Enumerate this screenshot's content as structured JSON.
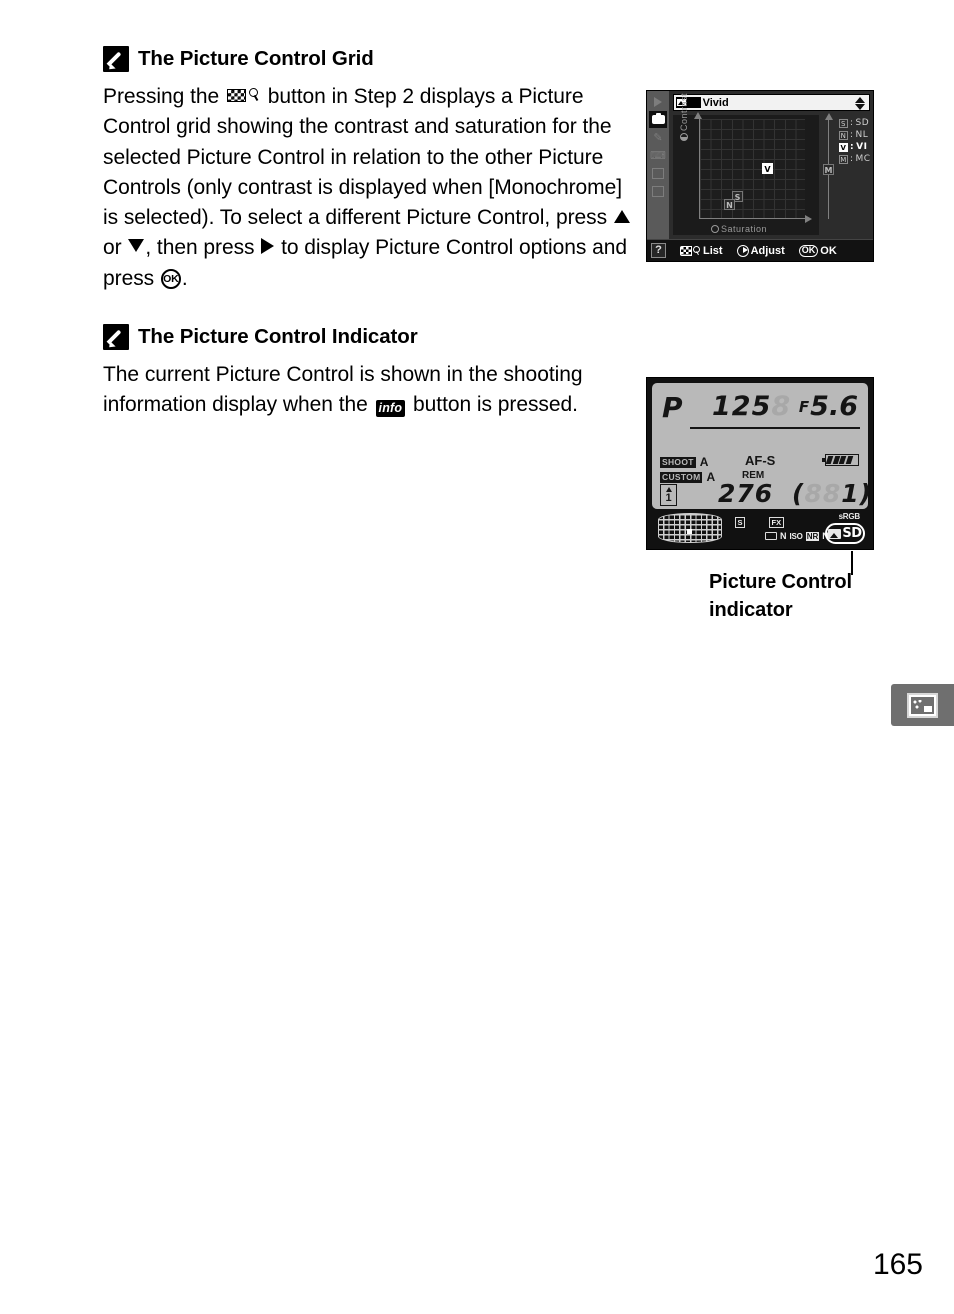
{
  "page": {
    "number": "165"
  },
  "notes": [
    {
      "icon": "pencil-icon",
      "title": "The Picture Control Grid",
      "body_segments": [
        "Pressing the ",
        " button in Step 2 displays a Picture Control grid showing the contrast and saturation for the selected Picture Control in relation to the other Picture Controls (only contrast is displayed when [Monochrome] is selected).  To select a different Picture Control, press ",
        " or ",
        ", then press ",
        " to display Picture Control options and press ",
        "."
      ],
      "icons_inline": [
        "thumbnail-zoom-out-button",
        "multi-selector-up",
        "multi-selector-down",
        "multi-selector-right",
        "ok-button"
      ]
    },
    {
      "icon": "pencil-icon",
      "title": "The Picture Control Indicator",
      "body_segments": [
        "The current Picture Control is shown in the shooting information display when the ",
        " button is pressed."
      ],
      "icons_inline": [
        "info-button"
      ],
      "info_label": "info"
    }
  ],
  "grid_lcd": {
    "title_code": "VI",
    "title_name": "Vivid",
    "axis_y": "Contrast",
    "axis_x": "Saturation",
    "markers": [
      {
        "code": "V",
        "selected": true,
        "x": 62,
        "y": 44
      },
      {
        "code": "S",
        "selected": false,
        "x": 32,
        "y": 72
      },
      {
        "code": "N",
        "selected": false,
        "x": 24,
        "y": 80
      }
    ],
    "mono_marker": {
      "code": "M",
      "selected": false
    },
    "legend": [
      {
        "chip": "S",
        "code": "SD",
        "selected": false
      },
      {
        "chip": "N",
        "code": "NL",
        "selected": false
      },
      {
        "chip": "V",
        "code": "VI",
        "selected": true
      },
      {
        "chip": "M",
        "code": "MC",
        "selected": false
      }
    ],
    "sidebar_icons": [
      "playback-icon",
      "shooting-menu-icon",
      "custom-settings-pencil-icon",
      "setup-wrench-icon",
      "retouch-icon",
      "recent-settings-icon",
      "help-icon"
    ],
    "help_label": "?",
    "footer": [
      {
        "icon": "thumbnail-list-icon",
        "label": "List"
      },
      {
        "icon": "command-dial-icon",
        "label": "Adjust"
      },
      {
        "icon": "ok-button-icon",
        "label": "OK",
        "badge": "OK"
      }
    ]
  },
  "info_lcd": {
    "exposure_mode": "P",
    "shutter_speed": "125",
    "shutter_ghost": "8",
    "aperture_prefix": "F",
    "aperture": "5.6",
    "shoot_bank_label": "SHOOT",
    "shoot_bank_value": "A",
    "custom_bank_label": "CUSTOM",
    "custom_bank_value": "A",
    "folder_number": "1",
    "af_mode": "AF-S",
    "rem_label": "REM",
    "exposures_remaining": "276",
    "buffer_open": "(",
    "buffer_ghost": "88",
    "buffer_value": "1",
    "buffer_close": ")",
    "image_size": "S",
    "image_area": "FX",
    "white_balance_code": "N",
    "iso_label": "ISO",
    "noise_reduction": "NR",
    "noise_reduction_state": "N",
    "color_space": "sRGB",
    "picture_control_code": "SD"
  },
  "caption": {
    "line1": "Picture Control",
    "line2": "indicator"
  },
  "tab_marker": {
    "icon": "retouch-menu-icon"
  }
}
